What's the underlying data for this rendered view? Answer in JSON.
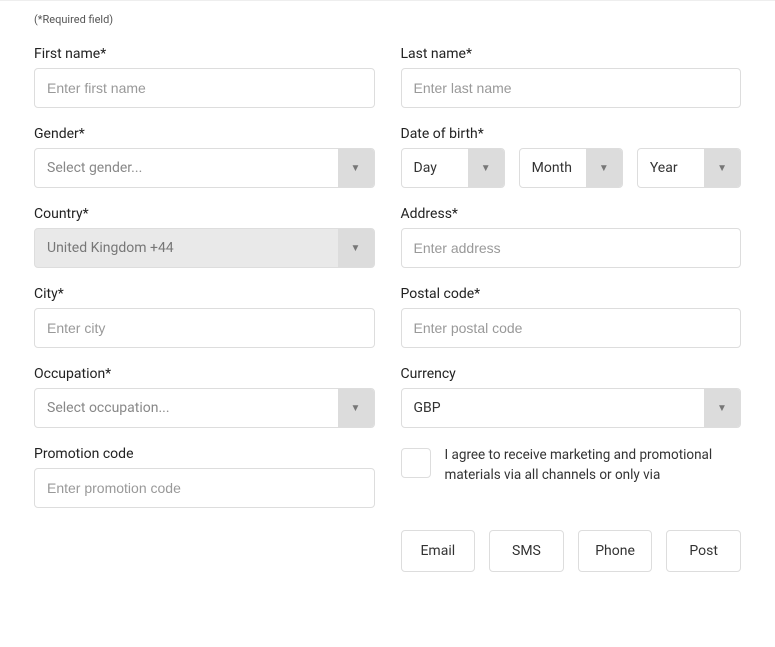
{
  "required_note": "(*Required field)",
  "fields": {
    "first_name": {
      "label": "First name*",
      "placeholder": "Enter first name"
    },
    "last_name": {
      "label": "Last name*",
      "placeholder": "Enter last name"
    },
    "gender": {
      "label": "Gender*",
      "selected": "Select gender..."
    },
    "dob": {
      "label": "Date of birth*",
      "day": "Day",
      "month": "Month",
      "year": "Year"
    },
    "country": {
      "label": "Country*",
      "selected": "United Kingdom +44"
    },
    "address": {
      "label": "Address*",
      "placeholder": "Enter address"
    },
    "city": {
      "label": "City*",
      "placeholder": "Enter city"
    },
    "postal": {
      "label": "Postal code*",
      "placeholder": "Enter postal code"
    },
    "occupation": {
      "label": "Occupation*",
      "selected": "Select occupation..."
    },
    "currency": {
      "label": "Currency",
      "selected": "GBP"
    },
    "promo": {
      "label": "Promotion code",
      "placeholder": "Enter promotion code"
    }
  },
  "consent": {
    "text": "I agree to receive marketing and promotional materials via all channels or only via",
    "channels": {
      "email": "Email",
      "sms": "SMS",
      "phone": "Phone",
      "post": "Post"
    }
  }
}
